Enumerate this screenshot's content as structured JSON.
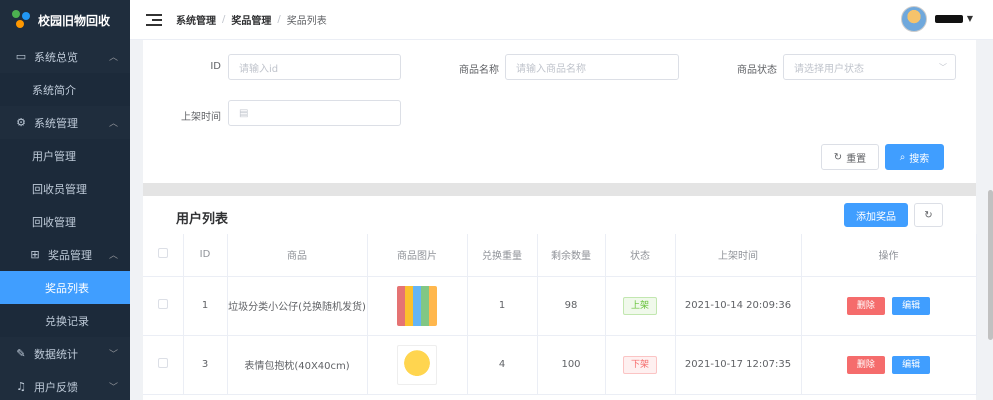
{
  "app": {
    "title": "校园旧物回收"
  },
  "sidebar": {
    "groups": [
      {
        "label": "系统总览",
        "icon": "monitor-icon",
        "items": [
          {
            "label": "系统简介"
          }
        ]
      },
      {
        "label": "系统管理",
        "icon": "gear-icon",
        "items": [
          {
            "label": "用户管理"
          },
          {
            "label": "回收员管理"
          },
          {
            "label": "回收管理"
          }
        ]
      },
      {
        "label": "奖品管理",
        "icon": "gift-icon",
        "items": [
          {
            "label": "奖品列表",
            "active": true
          },
          {
            "label": "兑换记录"
          }
        ]
      },
      {
        "label": "数据统计",
        "icon": "edit-icon"
      },
      {
        "label": "用户反馈",
        "icon": "bell-icon"
      }
    ]
  },
  "header": {
    "breadcrumb": [
      "系统管理",
      "奖品管理",
      "奖品列表"
    ],
    "separator": "/"
  },
  "search": {
    "id_label": "ID",
    "id_placeholder": "请输入id",
    "name_label": "商品名称",
    "name_placeholder": "请输入商品名称",
    "status_label": "商品状态",
    "status_placeholder": "请选择用户状态",
    "time_label": "上架时间",
    "reset_label": "重置",
    "search_label": "搜索"
  },
  "table": {
    "title": "用户列表",
    "add_label": "添加奖品",
    "columns": [
      "ID",
      "商品",
      "商品图片",
      "兑换重量",
      "剩余数量",
      "状态",
      "上架时间",
      "操作"
    ],
    "rows": [
      {
        "id": "1",
        "name": "垃圾分类小公仔(兑换随机发货)",
        "weight": "1",
        "remaining": "98",
        "status": "上架",
        "time": "2021-10-14 20:09:36"
      },
      {
        "id": "3",
        "name": "表情包抱枕(40X40cm)",
        "weight": "4",
        "remaining": "100",
        "status": "下架",
        "time": "2021-10-17 12:07:35"
      }
    ],
    "delete_label": "删除",
    "edit_label": "编辑"
  },
  "colors": {
    "primary": "#409eff",
    "sidebar_bg": "#1f2d3d",
    "danger": "#f56c6c",
    "success": "#67c23a"
  }
}
